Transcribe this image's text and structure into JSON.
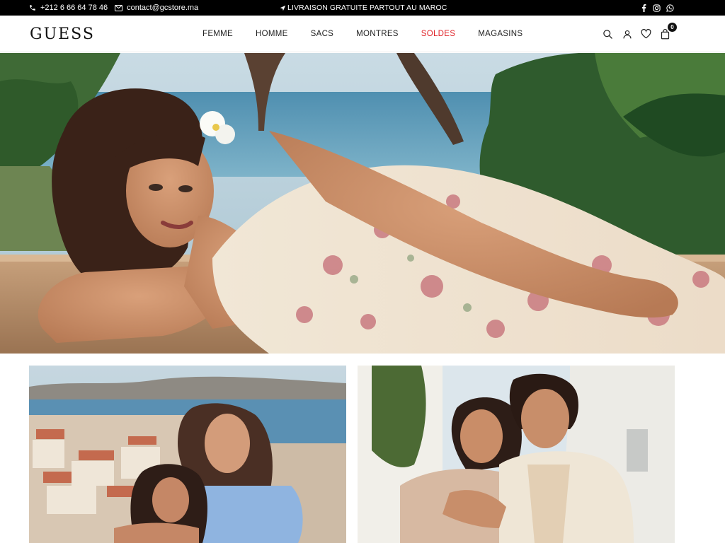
{
  "topbar": {
    "phone": "+212 6 66 64 78 46",
    "email": "contact@gcstore.ma",
    "announcement": "LIVRAISON GRATUITE PARTOUT AU MAROC",
    "social": [
      "facebook-icon",
      "instagram-icon",
      "whatsapp-icon"
    ]
  },
  "header": {
    "logo": "GUESS",
    "nav": [
      {
        "label": "FEMME"
      },
      {
        "label": "HOMME"
      },
      {
        "label": "SACS"
      },
      {
        "label": "MONTRES"
      },
      {
        "label": "SOLDES"
      },
      {
        "label": "MAGASINS"
      }
    ],
    "cart_count": "0",
    "icons": [
      "search-icon",
      "user-icon",
      "heart-icon",
      "bag-icon"
    ]
  },
  "colors": {
    "topbar_bg": "#000000",
    "sale_red": "#e0262b",
    "text": "#222222"
  }
}
